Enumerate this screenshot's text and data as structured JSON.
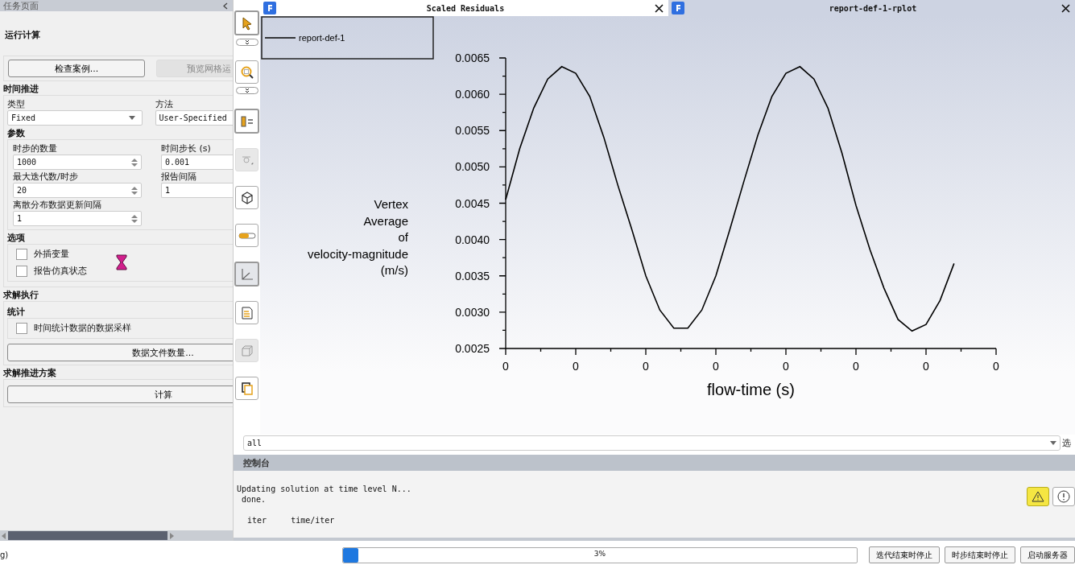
{
  "task_panel": {
    "title": "任务页面",
    "heading": "运行计算",
    "buttons": [
      {
        "label": "检查案例...",
        "disabled": false
      },
      {
        "label": "预览网格运",
        "disabled": true
      }
    ],
    "time_advance": {
      "title": "时间推进",
      "type_label": "类型",
      "type_value": "Fixed",
      "method_label": "方法",
      "method_value": "User-Specified",
      "params_title": "参数",
      "params": [
        {
          "label": "时步的数量",
          "value": "1000",
          "spinner": true
        },
        {
          "label": "时间步长 (s)",
          "value": "0.001",
          "spinner": false
        },
        {
          "label": "最大迭代数/时步",
          "value": "20",
          "spinner": true
        },
        {
          "label": "报告间隔",
          "value": "1",
          "spinner": false
        },
        {
          "label": "离散分布数据更新间隔",
          "value": "1",
          "spinner": true
        }
      ],
      "options_title": "选项",
      "options": [
        {
          "label": "外插变量",
          "checked": false
        },
        {
          "label": "报告仿真状态",
          "checked": false
        }
      ]
    },
    "solve": {
      "title": "求解执行",
      "stats_title": "统计",
      "stats_options": [
        {
          "label": "时间统计数据的数据采样",
          "checked": false
        }
      ],
      "button": "数据文件数量..."
    },
    "scheme": {
      "title": "求解推进方案",
      "button": "计算"
    }
  },
  "plot_tabs": [
    {
      "title": "Scaled Residuals",
      "selected": true
    },
    {
      "title": "report-def-1-rplot",
      "selected": false
    }
  ],
  "plot": {
    "chart_data": {
      "type": "line",
      "xlabel": "flow-time (s)",
      "ylabel": "Vertex Average of velocity-magnitude (m/s)",
      "ylim": [
        0.0025,
        0.0065
      ],
      "categories": [
        "0",
        null,
        null,
        null,
        null,
        "0",
        null,
        null,
        null,
        null,
        "0",
        null,
        null,
        null,
        null,
        "0",
        null,
        null,
        null,
        null,
        "0",
        null,
        null,
        null,
        null,
        "0",
        null,
        null,
        null,
        null,
        "0",
        null,
        null,
        null,
        null,
        "0"
      ],
      "yticks": [
        {
          "value": 0.0025,
          "label": "0.0025"
        },
        {
          "value": 0.003,
          "label": "0.0030"
        },
        {
          "value": 0.0035,
          "label": "0.0035"
        },
        {
          "value": 0.004,
          "label": "0.0040"
        },
        {
          "value": 0.0045,
          "label": "0.0045"
        },
        {
          "value": 0.005,
          "label": "0.0050"
        },
        {
          "value": 0.0055,
          "label": "0.0055"
        },
        {
          "value": 0.006,
          "label": "0.0060"
        },
        {
          "value": 0.0065,
          "label": "0.0065"
        }
      ],
      "series": [
        {
          "name": "report-def-1",
          "color": "#000000",
          "values": [
            0.00455,
            0.00525,
            0.00581,
            0.00621,
            0.00638,
            0.00629,
            0.00597,
            0.00541,
            0.00475,
            0.00414,
            0.0035,
            0.00303,
            0.00278,
            0.00278,
            0.00303,
            0.0035,
            0.00414,
            0.0048,
            0.00544,
            0.00597,
            0.00629,
            0.00638,
            0.00621,
            0.00581,
            0.00519,
            0.00447,
            0.00386,
            0.00333,
            0.0029,
            0.00274,
            0.00283,
            0.00316,
            0.00367,
            null,
            null,
            null
          ]
        }
      ]
    }
  },
  "filter": {
    "value": "all",
    "side_label": "选"
  },
  "console": {
    "title": "控制台",
    "lines": [
      "Updating solution at time level N...",
      "done.",
      "iter     time/iter"
    ]
  },
  "status_bar": {
    "left_text": "g)",
    "progress": {
      "level": 0.03,
      "label": "3%"
    },
    "buttons": [
      "迭代结束时停止",
      "时步结束时停止",
      "启动服务器"
    ]
  }
}
